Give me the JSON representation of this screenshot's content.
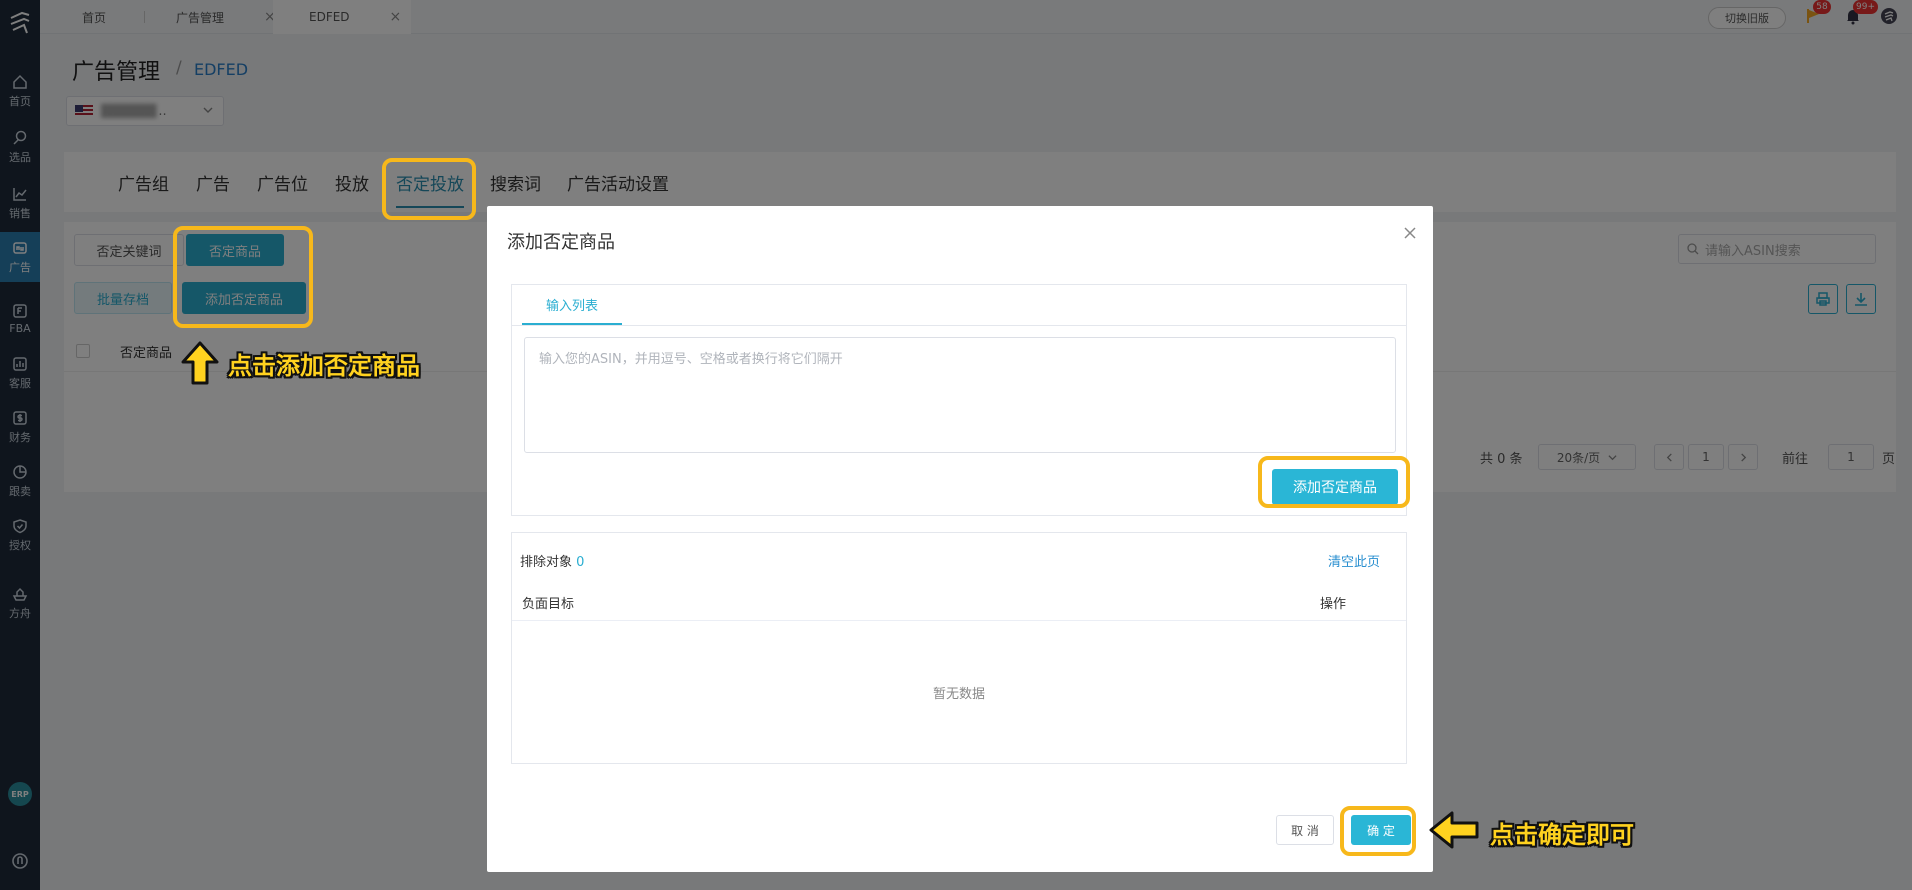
{
  "sidebar": {
    "items": [
      {
        "label": "首页",
        "icon": "home-icon"
      },
      {
        "label": "选品",
        "icon": "search-icon"
      },
      {
        "label": "销售",
        "icon": "chart-line-icon"
      },
      {
        "label": "广告",
        "icon": "ad-icon"
      },
      {
        "label": "FBA",
        "icon": "fba-icon"
      },
      {
        "label": "客服",
        "icon": "service-icon"
      },
      {
        "label": "财务",
        "icon": "dollar-icon"
      },
      {
        "label": "跟卖",
        "icon": "pie-icon"
      },
      {
        "label": "授权",
        "icon": "shield-icon"
      },
      {
        "label": "方舟",
        "icon": "ark-icon"
      }
    ],
    "erp_label": "ERP"
  },
  "topbar": {
    "tabs": [
      {
        "label": "首页"
      },
      {
        "label": "广告管理"
      },
      {
        "label": "EDFED"
      }
    ],
    "old_version_label": "切换旧版",
    "flag_badge": "58",
    "bell_badge": "99+"
  },
  "header": {
    "title": "广告管理",
    "separator": "/",
    "subtitle": "EDFED",
    "store_ellipsis": ".."
  },
  "main_tabs": [
    {
      "label": "广告组"
    },
    {
      "label": "广告"
    },
    {
      "label": "广告位"
    },
    {
      "label": "投放"
    },
    {
      "label": "否定投放"
    },
    {
      "label": "搜索词"
    },
    {
      "label": "广告活动设置"
    }
  ],
  "content": {
    "sub_tab_keyword": "否定关键词",
    "sub_tab_product": "否定商品",
    "batch_archive": "批量存档",
    "add_negative_product": "添加否定商品",
    "search_placeholder": "请输入ASIN搜索",
    "table_column": "否定商品",
    "pagination": {
      "total": "共 0 条",
      "page_size": "20条/页",
      "current_page": "1",
      "goto_prefix": "前往",
      "goto_value": "1",
      "goto_suffix": "页"
    }
  },
  "modal": {
    "title": "添加否定商品",
    "input_tab": "输入列表",
    "textarea_placeholder": "输入您的ASIN，并用逗号、空格或者换行将它们隔开",
    "add_button": "添加否定商品",
    "excluded_label": "排除对象",
    "excluded_count": "0",
    "clear_page": "清空此页",
    "col_target": "负面目标",
    "col_action": "操作",
    "empty_text": "暂无数据",
    "cancel": "取 消",
    "confirm": "确 定"
  },
  "annotations": {
    "click_add": "点击添加否定商品",
    "click_confirm": "点击确定即可",
    "highlight_color": "#f7b81b",
    "text_color": "#ffd21f"
  },
  "colors": {
    "primary": "#2aaed1",
    "sidebar_bg": "#1e2a3a",
    "link": "#2a8fd0"
  }
}
